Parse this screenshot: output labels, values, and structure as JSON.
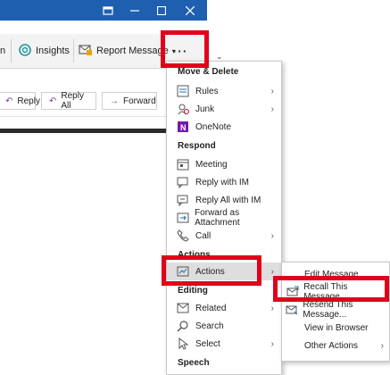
{
  "titlebar": {
    "icons": [
      "restore-window-icon",
      "minimize-icon",
      "maximize-icon",
      "close-icon"
    ],
    "accent": "#1f5fb0"
  },
  "ribbon": {
    "partial_label": "n",
    "insights_label": "Insights",
    "report_label": "Report Message",
    "more_label": "···"
  },
  "actions": {
    "reply": "Reply",
    "reply_all": "Reply All",
    "forward": "Forward"
  },
  "menu": {
    "section_move": "Move & Delete",
    "rules": "Rules",
    "junk": "Junk",
    "onenote": "OneNote",
    "section_respond": "Respond",
    "meeting": "Meeting",
    "reply_im": "Reply with IM",
    "reply_all_im": "Reply All with IM",
    "forward_attachment": "Forward as Attachment",
    "call": "Call",
    "section_actions": "Actions",
    "actions": "Actions",
    "section_editing": "Editing",
    "related": "Related",
    "search": "Search",
    "select": "Select",
    "section_speech": "Speech"
  },
  "submenu": {
    "edit_message": "Edit Message",
    "recall": "Recall This Message...",
    "resend": "Resend This Message...",
    "view_browser": "View in Browser",
    "other_actions": "Other Actions"
  },
  "highlight_color": "#e2001a"
}
